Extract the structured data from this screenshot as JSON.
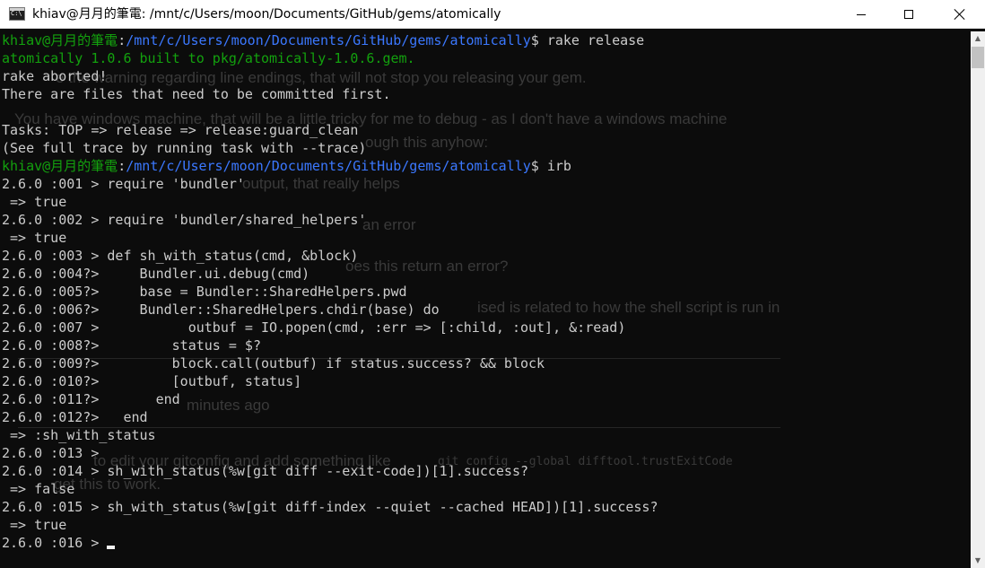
{
  "window": {
    "title": "khiav@月月的筆電: /mnt/c/Users/moon/Documents/GitHub/gems/atomically",
    "icon": "terminal-icon",
    "icon_glyph": "C:\\",
    "controls": {
      "minimize": "minimize-icon",
      "maximize": "maximize-icon",
      "close": "close-icon"
    }
  },
  "colors": {
    "background": "#0c0c0c",
    "text": "#cccccc",
    "prompt_user": "#13a10e",
    "prompt_path": "#3b78ff",
    "titlebar": "#ffffff"
  },
  "terminal": {
    "lines": [
      [
        {
          "t": "khiav@月月的筆電",
          "c": "green"
        },
        {
          "t": ":",
          "c": "white"
        },
        {
          "t": "/mnt/c/Users/moon/Documents/GitHub/gems/atomically",
          "c": "blue"
        },
        {
          "t": "$ rake release",
          "c": "white"
        }
      ],
      [
        {
          "t": "atomically 1.0.6 built to pkg/atomically-1.0.6.gem.",
          "c": "green"
        }
      ],
      [
        {
          "t": "rake aborted!",
          "c": "white"
        }
      ],
      [
        {
          "t": "There are files that need to be committed first.",
          "c": "white"
        }
      ],
      [
        {
          "t": "",
          "c": "white"
        }
      ],
      [
        {
          "t": "Tasks: TOP => release => release:guard_clean",
          "c": "white"
        }
      ],
      [
        {
          "t": "(See full trace by running task with --trace)",
          "c": "white"
        }
      ],
      [
        {
          "t": "khiav@月月的筆電",
          "c": "green"
        },
        {
          "t": ":",
          "c": "white"
        },
        {
          "t": "/mnt/c/Users/moon/Documents/GitHub/gems/atomically",
          "c": "blue"
        },
        {
          "t": "$ irb",
          "c": "white"
        }
      ],
      [
        {
          "t": "2.6.0 :001 > require 'bundler'",
          "c": "white"
        }
      ],
      [
        {
          "t": " => true",
          "c": "white"
        }
      ],
      [
        {
          "t": "2.6.0 :002 > require 'bundler/shared_helpers'",
          "c": "white"
        }
      ],
      [
        {
          "t": " => true",
          "c": "white"
        }
      ],
      [
        {
          "t": "2.6.0 :003 > def sh_with_status(cmd, &block)",
          "c": "white"
        }
      ],
      [
        {
          "t": "2.6.0 :004?>     Bundler.ui.debug(cmd)",
          "c": "white"
        }
      ],
      [
        {
          "t": "2.6.0 :005?>     base = Bundler::SharedHelpers.pwd",
          "c": "white"
        }
      ],
      [
        {
          "t": "2.6.0 :006?>     Bundler::SharedHelpers.chdir(base) do",
          "c": "white"
        }
      ],
      [
        {
          "t": "2.6.0 :007 >           outbuf = IO.popen(cmd, :err => [:child, :out], &:read)",
          "c": "white"
        }
      ],
      [
        {
          "t": "2.6.0 :008?>         status = $?",
          "c": "white"
        }
      ],
      [
        {
          "t": "2.6.0 :009?>         block.call(outbuf) if status.success? && block",
          "c": "white"
        }
      ],
      [
        {
          "t": "2.6.0 :010?>         [outbuf, status]",
          "c": "white"
        }
      ],
      [
        {
          "t": "2.6.0 :011?>       end",
          "c": "white"
        }
      ],
      [
        {
          "t": "2.6.0 :012?>   end",
          "c": "white"
        }
      ],
      [
        {
          "t": " => :sh_with_status",
          "c": "white"
        }
      ],
      [
        {
          "t": "2.6.0 :013 >",
          "c": "white"
        }
      ],
      [
        {
          "t": "2.6.0 :014 > sh_with_status(%w[git diff --exit-code])[1].success?",
          "c": "white"
        }
      ],
      [
        {
          "t": " => false",
          "c": "white"
        }
      ],
      [
        {
          "t": "2.6.0 :015 > sh_with_status(%w[git diff-index --quiet --cached HEAD])[1].success?",
          "c": "white"
        }
      ],
      [
        {
          "t": " => true",
          "c": "white"
        }
      ],
      [
        {
          "t": "2.6.0 :016 > ",
          "c": "white"
        }
      ]
    ]
  },
  "background_ghost": [
    {
      "text": "e the warning regarding line endings, that will not stop you releasing your gem.",
      "mono": false
    },
    {
      "text": "You have windows machine, that will be a little tricky for me to debug - as I don't have a windows machine",
      "mono": false
    },
    {
      "text": "ough this anyhow:",
      "mono": false
    },
    {
      "text": "output, that really helps",
      "mono": false
    },
    {
      "text": "an error",
      "mono": false
    },
    {
      "text": "oes this return an error?",
      "mono": false
    },
    {
      "text": "ised is related to how the shell script is run in",
      "mono": false
    },
    {
      "text": "minutes ago",
      "mono": false
    },
    {
      "text": "to edit your gitconfig and add something like",
      "mono": false
    },
    {
      "text": "git config --global difftool.trustExitCode",
      "mono": true
    },
    {
      "text": "get this to work.",
      "mono": false
    }
  ],
  "scrollbar": {
    "up_icon": "scroll-up-arrow-icon",
    "down_icon": "scroll-down-arrow-icon",
    "up_glyph": "▲",
    "down_glyph": "▼"
  }
}
